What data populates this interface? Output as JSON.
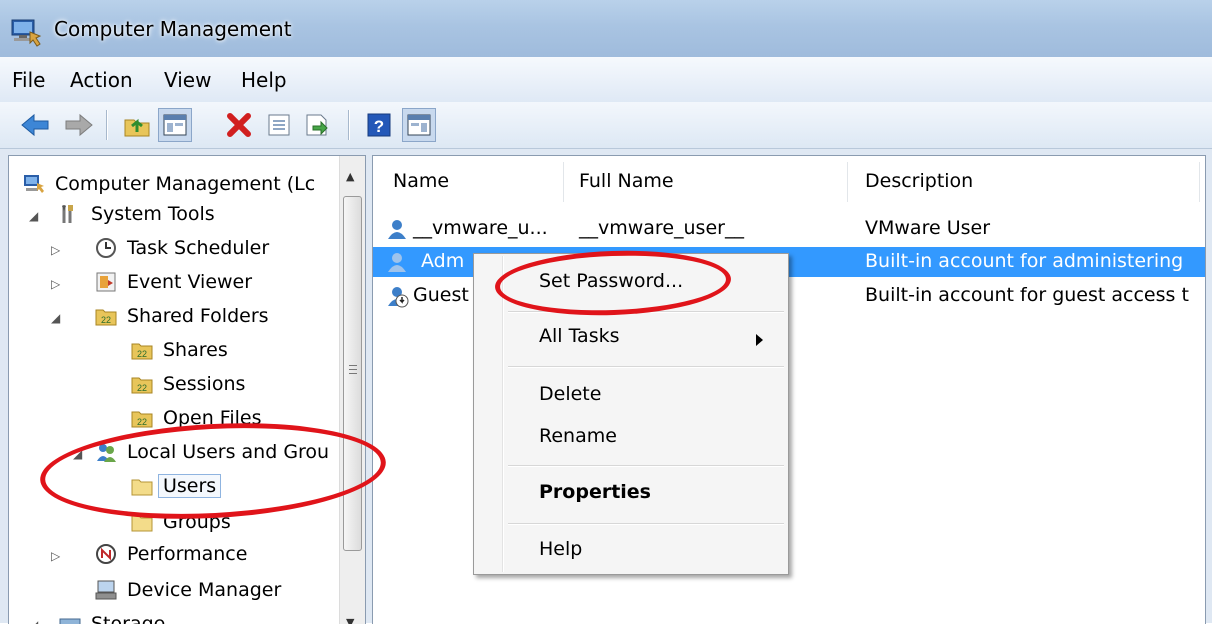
{
  "window": {
    "title": "Computer Management"
  },
  "menubar": [
    "File",
    "Action",
    "View",
    "Help"
  ],
  "toolbar": {
    "buttons": [
      "back-icon",
      "forward-icon",
      "up-folder-icon",
      "show-hide-console-tree-icon",
      "delete-icon",
      "properties-icon",
      "export-list-icon",
      "help-icon",
      "show-hide-action-pane-icon"
    ]
  },
  "tree": {
    "root": "Computer Management (Lc",
    "system_tools": "System Tools",
    "task_scheduler": "Task Scheduler",
    "event_viewer": "Event Viewer",
    "shared_folders": "Shared Folders",
    "shares": "Shares",
    "sessions": "Sessions",
    "open_files": "Open Files",
    "local_users": "Local Users and Grou",
    "users": "Users",
    "groups": "Groups",
    "performance": "Performance",
    "device_manager": "Device Manager",
    "storage": "Storage"
  },
  "list": {
    "columns": {
      "name": "Name",
      "full_name": "Full Name",
      "description": "Description"
    },
    "rows": [
      {
        "name": "__vmware_u...",
        "full_name": "__vmware_user__",
        "description": "VMware User"
      },
      {
        "name": "Adm",
        "full_name": "",
        "description": "Built-in account for administering"
      },
      {
        "name": "Guest",
        "full_name": "",
        "description": "Built-in account for guest access t"
      }
    ]
  },
  "context_menu": {
    "set_password": "Set Password...",
    "all_tasks": "All Tasks",
    "delete": "Delete",
    "rename": "Rename",
    "properties": "Properties",
    "help": "Help"
  },
  "colors": {
    "selection": "#3399ff",
    "annotation": "#e0141a"
  }
}
